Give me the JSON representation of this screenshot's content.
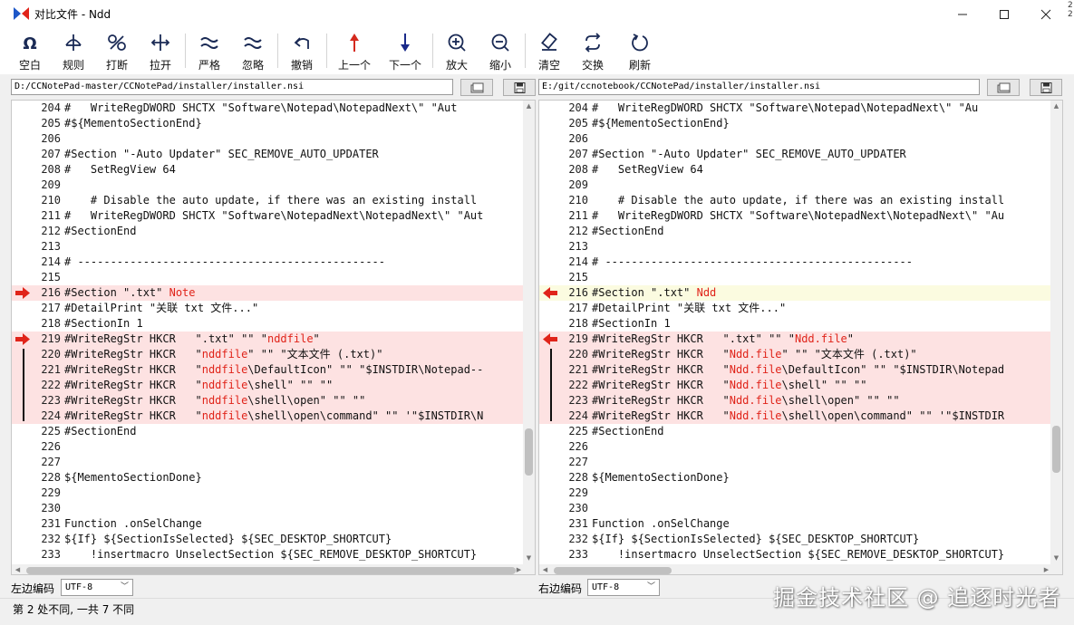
{
  "window": {
    "title": "对比文件 - Ndd",
    "edge_chars": [
      "2",
      "2"
    ]
  },
  "colors": {
    "diff_bg": "#fde2e2",
    "current_bg": "#fbfbe0",
    "marker": "#e0241a",
    "highlight": "#e0241a"
  },
  "toolbar": [
    {
      "label": "空白",
      "icon": "whitespace-icon"
    },
    {
      "label": "规则",
      "icon": "rule-icon"
    },
    {
      "label": "打断",
      "icon": "break-icon"
    },
    {
      "label": "拉开",
      "icon": "stretch-icon"
    },
    {
      "label": "严格",
      "icon": "strict-icon"
    },
    {
      "label": "忽略",
      "icon": "ignore-icon"
    },
    {
      "label": "撤销",
      "icon": "undo-icon"
    },
    {
      "label": "上一个",
      "icon": "prev-diff-icon"
    },
    {
      "label": "下一个",
      "icon": "next-diff-icon"
    },
    {
      "label": "放大",
      "icon": "zoom-in-icon"
    },
    {
      "label": "缩小",
      "icon": "zoom-out-icon"
    },
    {
      "label": "清空",
      "icon": "clear-icon"
    },
    {
      "label": "交换",
      "icon": "swap-icon"
    },
    {
      "label": "刷新",
      "icon": "refresh-icon"
    }
  ],
  "left": {
    "path": "D:/CCNotePad-master/CCNotePad/installer/installer.nsi",
    "encoding_label": "左边编码",
    "encoding": "UTF-8",
    "lines": [
      {
        "n": "204",
        "t": "#   WriteRegDWORD SHCTX \"Software\\Notepad\\NotepadNext\\\" \"Aut"
      },
      {
        "n": "205",
        "t": "#${MementoSectionEnd}"
      },
      {
        "n": "206",
        "t": ""
      },
      {
        "n": "207",
        "t": "#Section \"-Auto Updater\" SEC_REMOVE_AUTO_UPDATER"
      },
      {
        "n": "208",
        "t": "#   SetRegView 64"
      },
      {
        "n": "209",
        "t": ""
      },
      {
        "n": "210",
        "t": "    # Disable the auto update, if there was an existing install"
      },
      {
        "n": "211",
        "t": "#   WriteRegDWORD SHCTX \"Software\\NotepadNext\\NotepadNext\\\" \"Aut"
      },
      {
        "n": "212",
        "t": "#SectionEnd"
      },
      {
        "n": "213",
        "t": ""
      },
      {
        "n": "214",
        "t": "# -----------------------------------------------"
      },
      {
        "n": "215",
        "t": ""
      },
      {
        "n": "216",
        "a": "#Section \".txt\" ",
        "h": "Note",
        "b": ""
      },
      {
        "n": "217",
        "t": "#DetailPrint \"关联 txt 文件...\""
      },
      {
        "n": "218",
        "t": "#SectionIn 1"
      },
      {
        "n": "219",
        "a": "#WriteRegStr HKCR   \".txt\" \"\" \"",
        "h": "nddfile",
        "b": "\""
      },
      {
        "n": "220",
        "a": "#WriteRegStr HKCR   \"",
        "h": "nddfile",
        "b": "\" \"\" \"文本文件 (.txt)\""
      },
      {
        "n": "221",
        "a": "#WriteRegStr HKCR   \"",
        "h": "nddfile",
        "b": "\\DefaultIcon\" \"\" \"$INSTDIR\\Notepad--"
      },
      {
        "n": "222",
        "a": "#WriteRegStr HKCR   \"",
        "h": "nddfile",
        "b": "\\shell\" \"\" \"\""
      },
      {
        "n": "223",
        "a": "#WriteRegStr HKCR   \"",
        "h": "nddfile",
        "b": "\\shell\\open\" \"\" \"\""
      },
      {
        "n": "224",
        "a": "#WriteRegStr HKCR   \"",
        "h": "nddfile",
        "b": "\\shell\\open\\command\" \"\" '\"$INSTDIR\\N"
      },
      {
        "n": "225",
        "t": "#SectionEnd"
      },
      {
        "n": "226",
        "t": ""
      },
      {
        "n": "227",
        "t": ""
      },
      {
        "n": "228",
        "t": "${MementoSectionDone}"
      },
      {
        "n": "229",
        "t": ""
      },
      {
        "n": "230",
        "t": ""
      },
      {
        "n": "231",
        "t": "Function .onSelChange"
      },
      {
        "n": "232",
        "t": "${If} ${SectionIsSelected} ${SEC_DESKTOP_SHORTCUT}"
      },
      {
        "n": "233",
        "t": "    !insertmacro UnselectSection ${SEC_REMOVE_DESKTOP_SHORTCUT}"
      }
    ]
  },
  "right": {
    "path": "E:/git/ccnotebook/CCNotePad/installer/installer.nsi",
    "encoding_label": "右边编码",
    "encoding": "UTF-8",
    "lines": [
      {
        "n": "204",
        "t": "#   WriteRegDWORD SHCTX \"Software\\Notepad\\NotepadNext\\\" \"Au"
      },
      {
        "n": "205",
        "t": "#${MementoSectionEnd}"
      },
      {
        "n": "206",
        "t": ""
      },
      {
        "n": "207",
        "t": "#Section \"-Auto Updater\" SEC_REMOVE_AUTO_UPDATER"
      },
      {
        "n": "208",
        "t": "#   SetRegView 64"
      },
      {
        "n": "209",
        "t": ""
      },
      {
        "n": "210",
        "t": "    # Disable the auto update, if there was an existing install"
      },
      {
        "n": "211",
        "t": "#   WriteRegDWORD SHCTX \"Software\\NotepadNext\\NotepadNext\\\" \"Au"
      },
      {
        "n": "212",
        "t": "#SectionEnd"
      },
      {
        "n": "213",
        "t": ""
      },
      {
        "n": "214",
        "t": "# -----------------------------------------------"
      },
      {
        "n": "215",
        "t": ""
      },
      {
        "n": "216",
        "a": "#Section \".txt\" ",
        "h": "Ndd",
        "b": ""
      },
      {
        "n": "217",
        "t": "#DetailPrint \"关联 txt 文件...\""
      },
      {
        "n": "218",
        "t": "#SectionIn 1"
      },
      {
        "n": "219",
        "a": "#WriteRegStr HKCR   \".txt\" \"\" \"",
        "h": "Ndd.file",
        "b": "\""
      },
      {
        "n": "220",
        "a": "#WriteRegStr HKCR   \"",
        "h": "Ndd.file",
        "b": "\" \"\" \"文本文件 (.txt)\""
      },
      {
        "n": "221",
        "a": "#WriteRegStr HKCR   \"",
        "h": "Ndd.file",
        "b": "\\DefaultIcon\" \"\" \"$INSTDIR\\Notepad"
      },
      {
        "n": "222",
        "a": "#WriteRegStr HKCR   \"",
        "h": "Ndd.file",
        "b": "\\shell\" \"\" \"\""
      },
      {
        "n": "223",
        "a": "#WriteRegStr HKCR   \"",
        "h": "Ndd.file",
        "b": "\\shell\\open\" \"\" \"\""
      },
      {
        "n": "224",
        "a": "#WriteRegStr HKCR   \"",
        "h": "Ndd.file",
        "b": "\\shell\\open\\command\" \"\" '\"$INSTDIR"
      },
      {
        "n": "225",
        "t": "#SectionEnd"
      },
      {
        "n": "226",
        "t": ""
      },
      {
        "n": "227",
        "t": ""
      },
      {
        "n": "228",
        "t": "${MementoSectionDone}"
      },
      {
        "n": "229",
        "t": ""
      },
      {
        "n": "230",
        "t": ""
      },
      {
        "n": "231",
        "t": "Function .onSelChange"
      },
      {
        "n": "232",
        "t": "${If} ${SectionIsSelected} ${SEC_DESKTOP_SHORTCUT}"
      },
      {
        "n": "233",
        "t": "    !insertmacro UnselectSection ${SEC_REMOVE_DESKTOP_SHORTCUT}"
      }
    ]
  },
  "status": "第 2 处不同,  一共 7 不同",
  "watermark": "掘金技术社区 @ 追逐时光者"
}
